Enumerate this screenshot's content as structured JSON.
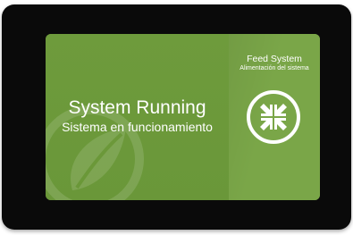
{
  "status": {
    "title": "System Running",
    "subtitle": "Sistema en funcionamiento"
  },
  "feed": {
    "title": "Feed System",
    "subtitle": "Alimentación del sistema",
    "icon": "collapse-arrows-icon"
  },
  "colors": {
    "panel_main": "#6e9b3c",
    "panel_side": "#7aa648",
    "bezel": "#0a0a0a",
    "text": "#ffffff"
  }
}
